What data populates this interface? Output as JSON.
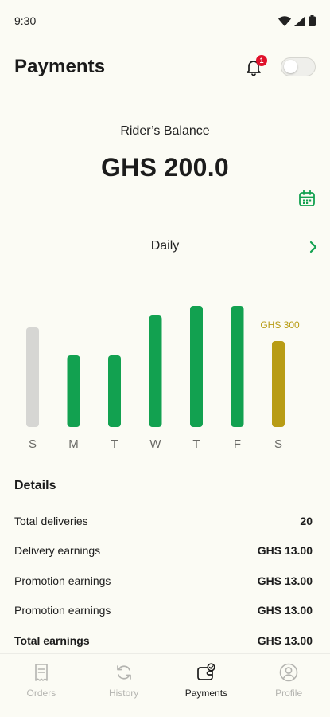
{
  "status_bar": {
    "time": "9:30"
  },
  "header": {
    "title": "Payments",
    "notification_count": "1"
  },
  "balance": {
    "label": "Rider’s Balance",
    "amount": "GHS 200.0"
  },
  "period": {
    "label": "Daily"
  },
  "colors": {
    "accent_green": "#12a150",
    "highlight_gold": "#b89c15",
    "inactive_gray": "#d6d6d3",
    "badge_red": "#e0112b",
    "background": "#fbfbf4"
  },
  "chart_data": {
    "type": "bar",
    "categories": [
      "S",
      "M",
      "T",
      "W",
      "T",
      "F",
      "S"
    ],
    "values": [
      125,
      90,
      90,
      140,
      152,
      152,
      108
    ],
    "ylim": [
      0,
      160
    ],
    "bar_states": [
      "inactive",
      "active",
      "active",
      "active",
      "active",
      "active",
      "selected"
    ],
    "annotations": [
      {
        "index": 6,
        "text": "GHS 300"
      }
    ]
  },
  "details": {
    "title": "Details",
    "rows": [
      {
        "label": "Total deliveries",
        "value": "20"
      },
      {
        "label": "Delivery earnings",
        "value": "GHS 13.00"
      },
      {
        "label": "Promotion earnings",
        "value": "GHS 13.00"
      },
      {
        "label": "Promotion earnings",
        "value": "GHS 13.00"
      },
      {
        "label": "Total earnings",
        "value": "GHS 13.00"
      }
    ]
  },
  "nav": {
    "items": [
      {
        "label": "Orders",
        "icon": "receipt-icon"
      },
      {
        "label": "History",
        "icon": "refresh-icon"
      },
      {
        "label": "Payments",
        "icon": "wallet-icon"
      },
      {
        "label": "Profile",
        "icon": "user-icon"
      }
    ],
    "active_index": 2
  }
}
